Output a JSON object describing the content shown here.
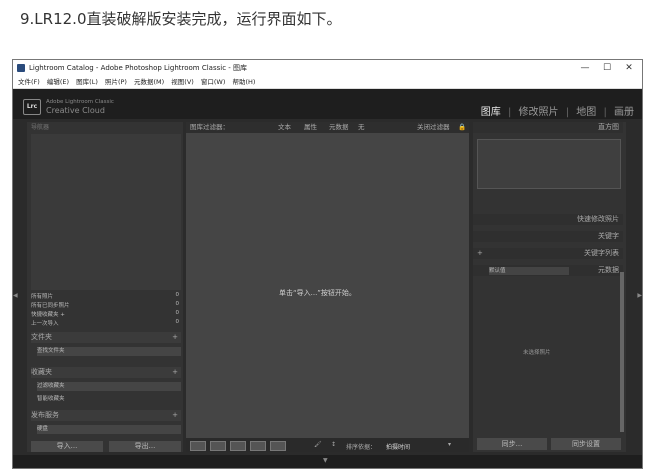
{
  "caption": "9.LR12.0直装破解版安装完成，运行界面如下。",
  "window": {
    "title": "Lightroom Catalog - Adobe Photoshop Lightroom Classic - 图库",
    "controls": [
      "—",
      "☐",
      "✕"
    ]
  },
  "menu": [
    "文件(F)",
    "编辑(E)",
    "图库(L)",
    "照片(P)",
    "元数据(M)",
    "视图(V)",
    "窗口(W)",
    "帮助(H)"
  ],
  "brand": {
    "logo": "Lrc",
    "line1": "Adobe Lightroom Classic",
    "line2": "Creative Cloud"
  },
  "modules": [
    "图库",
    "修改照片",
    "地图",
    "画册"
  ],
  "left_panel": {
    "navigator_title": "导航器",
    "catalog": [
      {
        "label": "所有照片",
        "count": "0"
      },
      {
        "label": "所有已同步照片",
        "count": "0"
      },
      {
        "label": "快捷收藏夹 +",
        "count": "0"
      },
      {
        "label": "上一次导入",
        "count": "0"
      }
    ],
    "folders_title": "文件夹",
    "folders_sub": "查找文件夹",
    "collections_title": "收藏夹",
    "collections_sub1": "过滤收藏夹",
    "collections_sub2": "智能收藏夹",
    "publish_title": "发布服务",
    "publish_sub": "硬盘",
    "import_label": "导入...",
    "export_label": "导出..."
  },
  "filter_bar": {
    "title": "图库过滤器：",
    "items": [
      "文本",
      "属性",
      "元数据",
      "无"
    ],
    "preset": "关闭过滤器"
  },
  "center_message": "单击“导入...”按钮开始。",
  "toolbar": {
    "sort_label": "排序依据：",
    "sort_value": "拍摄时间"
  },
  "right_panel": {
    "histogram_title": "直方图",
    "quick_develop": "快速修改照片",
    "keywording": "关键字",
    "keyword_list": "关键字列表",
    "metadata": "元数据",
    "metadata_preset": "默认值",
    "no_photo": "未选择照片",
    "sync_label": "同步...",
    "sync_settings_label": "同步设置"
  }
}
